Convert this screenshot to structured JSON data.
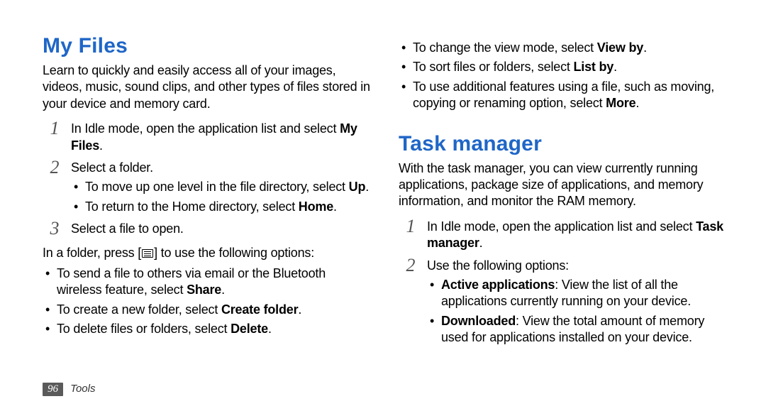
{
  "left": {
    "heading": "My Files",
    "intro": "Learn to quickly and easily access all of your images, videos, music, sound clips, and other types of files stored in your device and memory card.",
    "step1_a": "In Idle mode, open the application list and select ",
    "step1_b": "My Files",
    "step1_c": ".",
    "step2": "Select a folder.",
    "step2_b1_a": "To move up one level in the file directory, select ",
    "step2_b1_b": "Up",
    "step2_b1_c": ".",
    "step2_b2_a": "To return to the Home directory, select ",
    "step2_b2_b": "Home",
    "step2_b2_c": ".",
    "step3": "Select a file to open.",
    "para_a": "In a folder, press [",
    "para_b": "] to use the following options:",
    "opt1_a": "To send a file to others via email or the Bluetooth wireless feature, select ",
    "opt1_b": "Share",
    "opt1_c": ".",
    "opt2_a": "To create a new folder, select ",
    "opt2_b": "Create folder",
    "opt2_c": ".",
    "opt3_a": "To delete files or folders, select ",
    "opt3_b": "Delete",
    "opt3_c": "."
  },
  "right_top": {
    "b1_a": "To change the view mode, select ",
    "b1_b": "View by",
    "b1_c": ".",
    "b2_a": "To sort files or folders, select ",
    "b2_b": "List by",
    "b2_c": ".",
    "b3_a": "To use additional features using a file, such as moving, copying or renaming option, select ",
    "b3_b": "More",
    "b3_c": "."
  },
  "right": {
    "heading": "Task manager",
    "intro": "With the task manager, you can view currently running applications, package size of applications, and memory information, and monitor the RAM memory.",
    "step1_a": "In Idle mode, open the application list and select ",
    "step1_b": "Task manager",
    "step1_c": ".",
    "step2": "Use the following options:",
    "b1_a": "Active applications",
    "b1_b": ": View the list of all the applications currently running on your device.",
    "b2_a": "Downloaded",
    "b2_b": ": View the total amount of memory used for applications installed on your device."
  },
  "footer": {
    "page": "96",
    "section": "Tools"
  },
  "nums": {
    "n1": "1",
    "n2": "2",
    "n3": "3"
  }
}
